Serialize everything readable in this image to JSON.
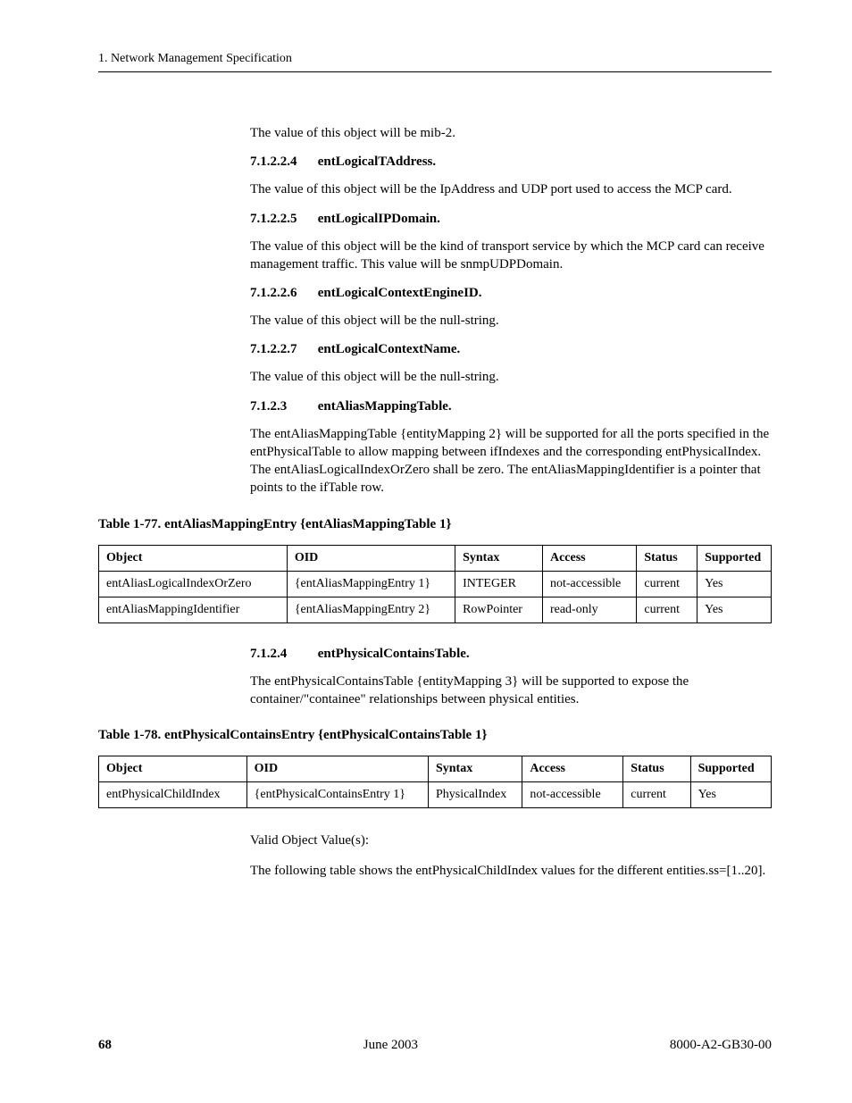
{
  "header": {
    "running": "1. Network Management Specification"
  },
  "body": {
    "intro_para": "The value of this object will be mib-2.",
    "s71224": {
      "num": "7.1.2.2.4",
      "title": "entLogicalTAddress.",
      "para": "The value of this object will be the IpAddress and UDP port used to access the MCP card."
    },
    "s71225": {
      "num": "7.1.2.2.5",
      "title": "entLogicalIPDomain.",
      "para": "The value of this object will be the kind of transport service by which the MCP card can receive management traffic. This value will be snmpUDPDomain."
    },
    "s71226": {
      "num": "7.1.2.2.6",
      "title": "entLogicalContextEngineID.",
      "para": "The value of this object will be the null-string."
    },
    "s71227": {
      "num": "7.1.2.2.7",
      "title": "entLogicalContextName.",
      "para": "The value of this object will be the null-string."
    },
    "s7123": {
      "num": "7.1.2.3",
      "title": "entAliasMappingTable.",
      "para": "The entAliasMappingTable {entityMapping 2} will be supported for all the ports specified in the entPhysicalTable to allow mapping between ifIndexes and the corresponding entPhysicalIndex. The entAliasLogicalIndexOrZero shall be zero. The entAliasMappingIdentifier is a pointer that points to the ifTable row."
    },
    "s7124": {
      "num": "7.1.2.4",
      "title": "entPhysicalContainsTable.",
      "para": "The entPhysicalContainsTable {entityMapping 3} will be supported to expose the container/\"containee\" relationships between physical entities."
    },
    "closing_para1": "Valid Object Value(s):",
    "closing_para2": "The following table shows the entPhysicalChildIndex values for the different entities.ss=[1..20]."
  },
  "table77": {
    "caption": "Table 1-77.  entAliasMappingEntry {entAliasMappingTable 1}",
    "headers": {
      "c1": "Object",
      "c2": "OID",
      "c3": "Syntax",
      "c4": "Access",
      "c5": "Status",
      "c6": "Supported"
    },
    "rows": [
      {
        "c1": "entAliasLogicalIndexOrZero",
        "c2": "{entAliasMappingEntry 1}",
        "c3": "INTEGER",
        "c4": "not-accessible",
        "c5": "current",
        "c6": "Yes"
      },
      {
        "c1": "entAliasMappingIdentifier",
        "c2": "{entAliasMappingEntry 2}",
        "c3": "RowPointer",
        "c4": "read-only",
        "c5": "current",
        "c6": "Yes"
      }
    ]
  },
  "table78": {
    "caption": "Table 1-78.  entPhysicalContainsEntry {entPhysicalContainsTable 1}",
    "headers": {
      "c1": "Object",
      "c2": "OID",
      "c3": "Syntax",
      "c4": "Access",
      "c5": "Status",
      "c6": "Supported"
    },
    "rows": [
      {
        "c1": "entPhysicalChildIndex",
        "c2": "{entPhysicalContainsEntry 1}",
        "c3": "PhysicalIndex",
        "c4": "not-accessible",
        "c5": "current",
        "c6": "Yes"
      }
    ]
  },
  "footer": {
    "page": "68",
    "center": "June 2003",
    "right": "8000-A2-GB30-00"
  }
}
